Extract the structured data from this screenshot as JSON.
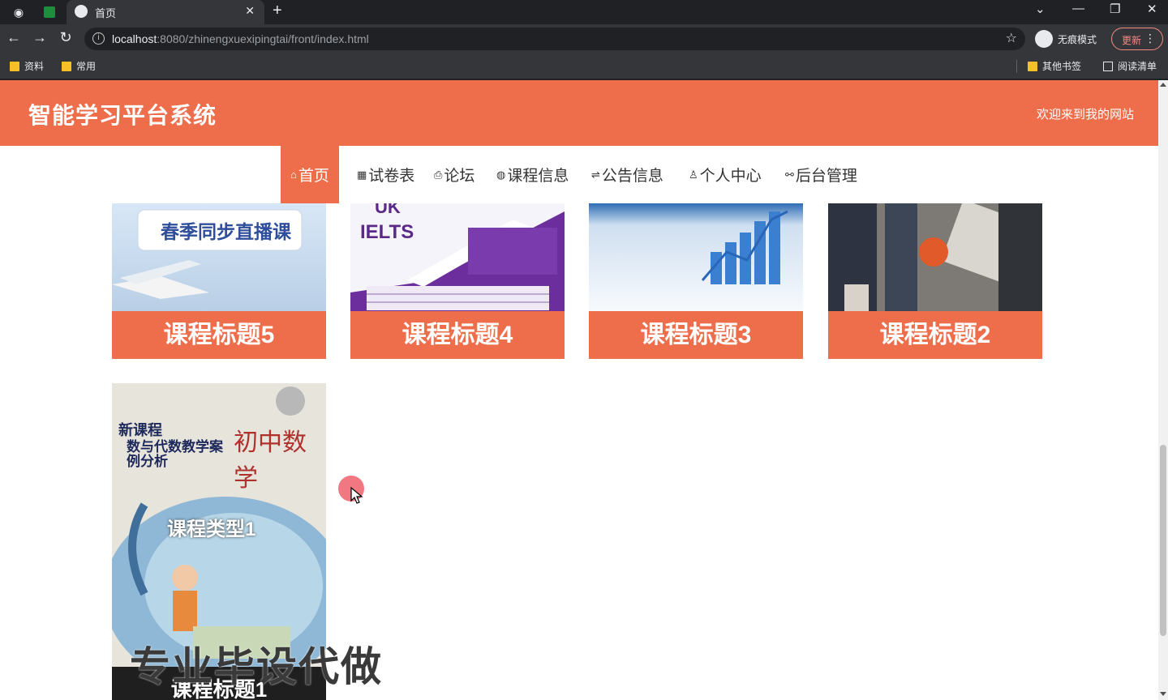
{
  "browser": {
    "tab_title": "首页",
    "new_tab": "+",
    "url_host": "localhost",
    "url_rest": ":8080/zhinengxuexipingtai/front/index.html",
    "incognito_label": "无痕模式",
    "update_label": "更新",
    "bookmarks": [
      "资料",
      "常用"
    ],
    "other_bookmarks": "其他书签",
    "reading_list": "阅读清单"
  },
  "site": {
    "title": "智能学习平台系统",
    "welcome": "欢迎来到我的网站"
  },
  "nav": {
    "items": [
      {
        "label": "首页",
        "icon": "home-icon",
        "glyph": "⌂"
      },
      {
        "label": "试卷表",
        "icon": "grid-icon",
        "glyph": "▦"
      },
      {
        "label": "论坛",
        "icon": "printer-icon",
        "glyph": "⎙"
      },
      {
        "label": "课程信息",
        "icon": "globe-icon",
        "glyph": "◍"
      },
      {
        "label": "公告信息",
        "icon": "sliders-icon",
        "glyph": "⇌"
      },
      {
        "label": "个人中心",
        "icon": "user-icon",
        "glyph": "♙"
      },
      {
        "label": "后台管理",
        "icon": "link-icon",
        "glyph": "⚯"
      }
    ]
  },
  "cards": [
    {
      "title": "课程标题5",
      "image_text": "春季同步直播课"
    },
    {
      "title": "课程标题4",
      "image_text_1": "UK",
      "image_text_2": "IELTS"
    },
    {
      "title": "课程标题3"
    },
    {
      "title": "课程标题2"
    },
    {
      "title": "课程标题1",
      "image_text_1": "新课程",
      "image_text_2": "数与代数教学案例分析",
      "image_text_3": "初中数学",
      "image_text_4": "课程类型1"
    }
  ],
  "watermark": "专业毕设代做",
  "colors": {
    "accent": "#ee6d4b",
    "chrome_dark": "#202124",
    "chrome": "#35363a"
  }
}
